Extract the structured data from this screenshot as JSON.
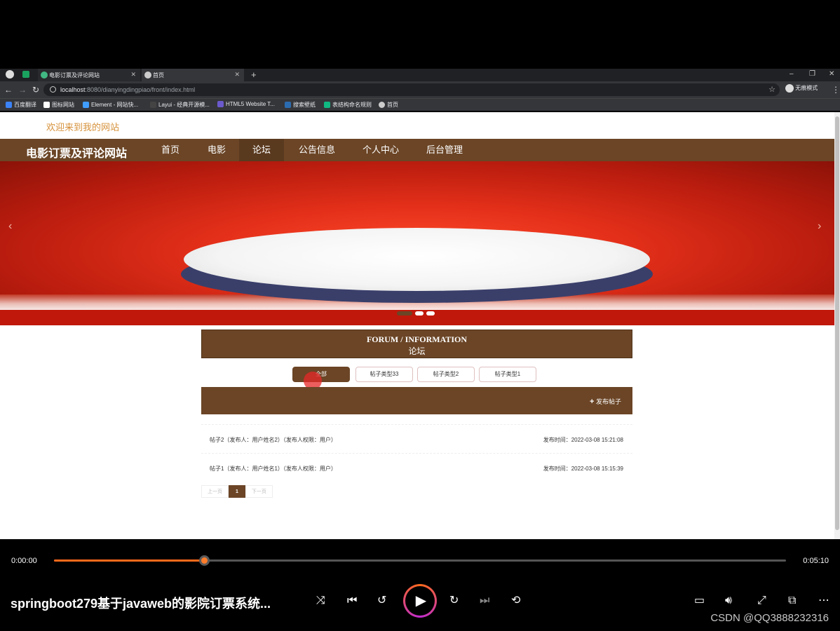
{
  "browser": {
    "tabs": [
      {
        "label": "电影订票及评论网站"
      },
      {
        "label": "首页"
      }
    ],
    "url_host": "localhost",
    "url_path": ":8080/dianyingdingpiao/front/index.html",
    "profile_label": "无痕模式",
    "bookmarks": [
      "百度翻译",
      "图标网站",
      "Element - 网站快...",
      "Layui - 经典开源模...",
      "HTML5 Website T...",
      "搜索壁纸",
      "表结构命名规则",
      "首页"
    ]
  },
  "page": {
    "welcome": "欢迎来到我的网站",
    "site_name": "电影订票及评论网站",
    "nav": [
      "首页",
      "电影",
      "论坛",
      "公告信息",
      "个人中心",
      "后台管理"
    ],
    "active_nav": "论坛",
    "forum_title_en": "FORUM / INFORMATION",
    "forum_title_cn": "论坛",
    "categories": [
      "全部",
      "帖子类型33",
      "帖子类型2",
      "帖子类型1"
    ],
    "post_button": "发布帖子",
    "posts": [
      {
        "title": "帖子2（发布人：用户姓名2）（发布人权限：用户）",
        "date": "发布时间：2022-03-08 15:21:08"
      },
      {
        "title": "帖子1（发布人：用户姓名1）（发布人权限：用户）",
        "date": "发布时间：2022-03-08 15:15:39"
      }
    ],
    "pager": {
      "prev": "上一页",
      "current": "1",
      "next": "下一页"
    }
  },
  "player": {
    "time_current": "0:00:00",
    "time_total": "0:05:10",
    "progress": 0.205,
    "title": "springboot279基于javaweb的影院订票系统...",
    "watermark": "CSDN @QQ3888232316"
  },
  "colors": {
    "brand_brown": "#6b4526",
    "welcome_orange": "#d6913a",
    "progress_orange": "#ff6a1a"
  }
}
